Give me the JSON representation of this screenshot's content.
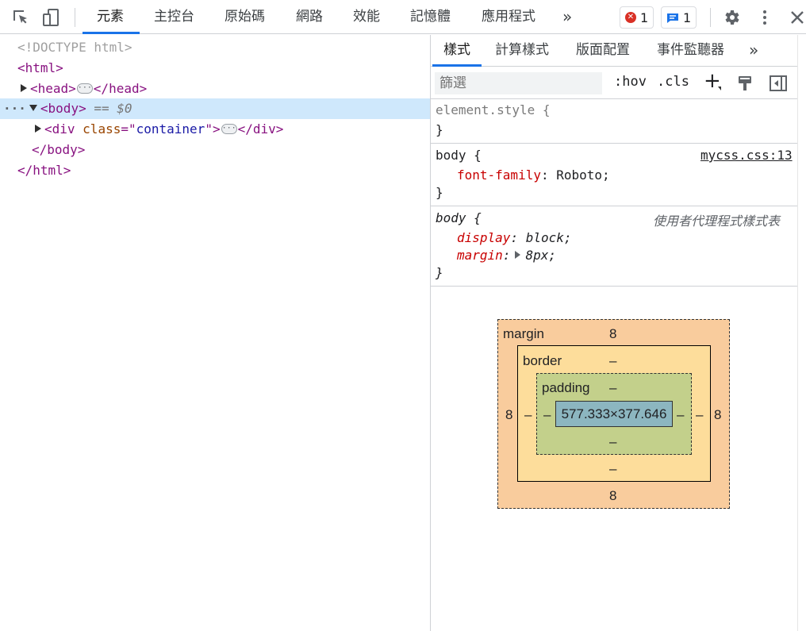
{
  "toolbar": {
    "tabs": [
      "元素",
      "主控台",
      "原始碼",
      "網路",
      "效能",
      "記憶體",
      "應用程式"
    ],
    "more": "»",
    "error_count": "1",
    "message_count": "1"
  },
  "dom": {
    "doctype": "<!DOCTYPE html>",
    "html_open": "<html>",
    "head_open": "<head>",
    "head_close": "</head>",
    "body_open": "<body>",
    "body_eq": " == $0",
    "div_open_start": "<div ",
    "div_attr_name": "class",
    "div_attr_eq": "=\"",
    "div_attr_value": "container",
    "div_attr_end": "\">",
    "div_close": "</div>",
    "body_close": "</body>",
    "html_close": "</html>"
  },
  "styles": {
    "tabs": [
      "樣式",
      "計算樣式",
      "版面配置",
      "事件監聽器"
    ],
    "more": "»",
    "filter_placeholder": "篩選",
    "hov": ":hov",
    "cls": ".cls",
    "plus": "+",
    "rules": {
      "element_style_selector": "element.style {",
      "element_style_close": "}",
      "body1_selector": "body {",
      "body1_source": "mycss.css:13",
      "body1_prop": "font-family",
      "body1_value": "Roboto;",
      "body1_close": "}",
      "body2_selector": "body {",
      "body2_source": "使用者代理程式樣式表",
      "body2_prop1": "display",
      "body2_value1": "block;",
      "body2_prop2": "margin",
      "body2_value2": "8px;",
      "body2_close": "}"
    }
  },
  "box_model": {
    "margin_label": "margin",
    "border_label": "border",
    "padding_label": "padding",
    "margin_top": "8",
    "margin_bottom": "8",
    "margin_left": "8",
    "margin_right": "8",
    "border_top": "–",
    "border_bottom": "–",
    "border_left": "–",
    "border_right": "–",
    "padding_top": "–",
    "padding_bottom": "–",
    "padding_left": "–",
    "padding_right": "–",
    "content": "577.333×377.646"
  },
  "colors": {
    "accent": "#1a73e8",
    "selected_row": "#cfe8fc",
    "margin": "#f9cc9d",
    "border": "#fddd9b",
    "padding": "#c3d08b",
    "content": "#8cb6c0",
    "tag": "#881280",
    "css_property": "#c80000"
  }
}
